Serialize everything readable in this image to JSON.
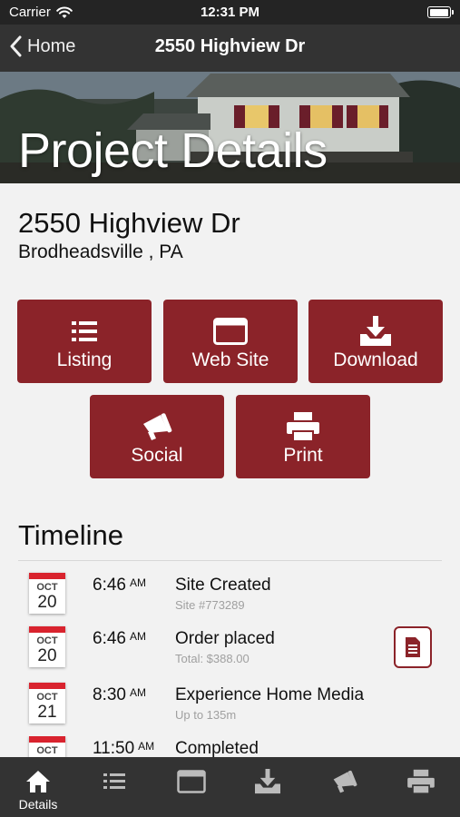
{
  "status_bar": {
    "carrier": "Carrier",
    "time": "12:31 PM"
  },
  "nav": {
    "back_label": "Home",
    "title": "2550 Highview Dr"
  },
  "hero": {
    "title": "Project Details"
  },
  "address": {
    "line1": "2550 Highview Dr",
    "line2": "Brodheadsville , PA"
  },
  "actions": [
    {
      "label": "Listing",
      "icon": "list-icon"
    },
    {
      "label": "Web Site",
      "icon": "browser-window-icon"
    },
    {
      "label": "Download",
      "icon": "download-icon"
    },
    {
      "label": "Social",
      "icon": "megaphone-icon"
    },
    {
      "label": "Print",
      "icon": "printer-icon"
    }
  ],
  "timeline": {
    "title": "Timeline",
    "items": [
      {
        "month": "OCT",
        "day": "20",
        "time": "6:46",
        "ampm": "AM",
        "title": "Site Created",
        "subtitle": "Site #773289"
      },
      {
        "month": "OCT",
        "day": "20",
        "time": "6:46",
        "ampm": "AM",
        "title": "Order placed",
        "subtitle": "Total: $388.00",
        "action_icon": "document-icon"
      },
      {
        "month": "OCT",
        "day": "21",
        "time": "8:30",
        "ampm": "AM",
        "title": "Experience Home Media",
        "subtitle": "Up to 135m"
      },
      {
        "month": "OCT",
        "day": "",
        "time": "11:50",
        "ampm": "AM",
        "title": "Completed",
        "subtitle": ""
      }
    ]
  },
  "tab_bar": {
    "tabs": [
      {
        "label": "Details",
        "icon": "home-icon",
        "active": true
      },
      {
        "label": "",
        "icon": "list-icon"
      },
      {
        "label": "",
        "icon": "browser-window-icon"
      },
      {
        "label": "",
        "icon": "download-icon"
      },
      {
        "label": "",
        "icon": "megaphone-icon"
      },
      {
        "label": "",
        "icon": "printer-icon"
      }
    ]
  },
  "colors": {
    "accent": "#8b2329",
    "calendar_red": "#d9232e",
    "bar_bg": "#333333",
    "page_bg": "#f2f2f2"
  }
}
